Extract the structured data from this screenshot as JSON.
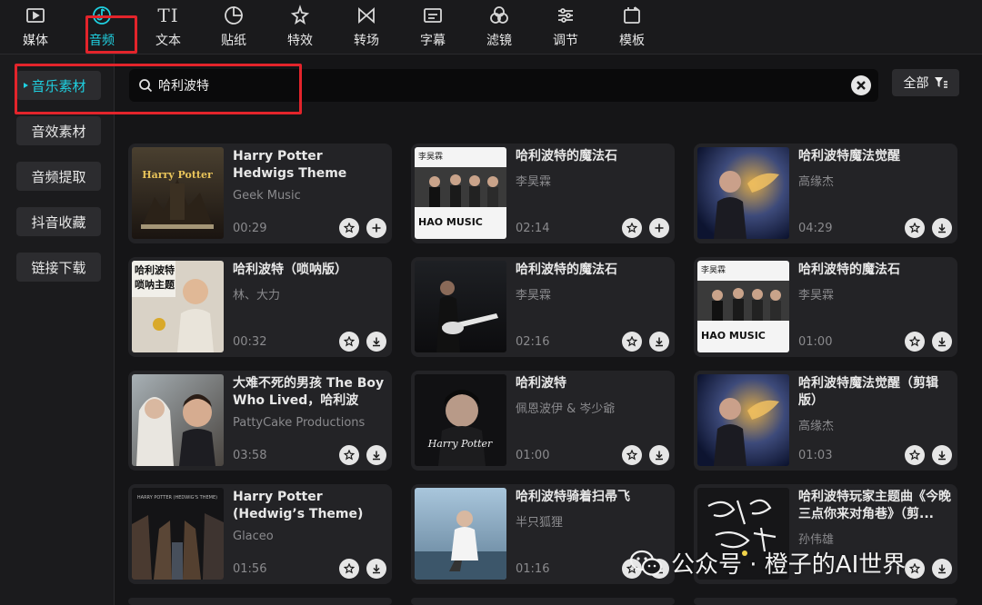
{
  "toolbar": {
    "items": [
      {
        "label": "媒体",
        "icon": "play-icon"
      },
      {
        "label": "音频",
        "icon": "audio-icon",
        "active": true
      },
      {
        "label": "文本",
        "icon": "text-icon"
      },
      {
        "label": "贴纸",
        "icon": "sticker-icon"
      },
      {
        "label": "特效",
        "icon": "sparkle-icon"
      },
      {
        "label": "转场",
        "icon": "transition-icon"
      },
      {
        "label": "字幕",
        "icon": "subtitle-icon"
      },
      {
        "label": "滤镜",
        "icon": "filter-icon"
      },
      {
        "label": "调节",
        "icon": "adjust-icon"
      },
      {
        "label": "模板",
        "icon": "template-icon"
      }
    ],
    "text_glyph": "TI"
  },
  "sidebar": {
    "items": [
      {
        "label": "音乐素材",
        "active": true
      },
      {
        "label": "音效素材"
      },
      {
        "label": "音频提取"
      },
      {
        "label": "抖音收藏"
      },
      {
        "label": "链接下载"
      }
    ]
  },
  "search": {
    "value": "哈利波特"
  },
  "filter": {
    "label": "全部"
  },
  "cards": [
    {
      "title": "Harry Potter Hedwigs Theme",
      "artist": "Geek Music",
      "duration": "00:29",
      "action": "add"
    },
    {
      "title": "哈利波特的魔法石",
      "artist": "李昊霖",
      "duration": "02:14",
      "action": "add"
    },
    {
      "title": "哈利波特魔法觉醒",
      "artist": "高缘杰",
      "duration": "04:29",
      "action": "download"
    },
    {
      "title": "哈利波特（唢呐版）",
      "artist": "林、大力",
      "duration": "00:32",
      "action": "download"
    },
    {
      "title": "哈利波特的魔法石",
      "artist": "李昊霖",
      "duration": "02:16",
      "action": "download"
    },
    {
      "title": "哈利波特的魔法石",
      "artist": "李昊霖",
      "duration": "01:00",
      "action": "download"
    },
    {
      "title": "大难不死的男孩 The Boy Who Lived，哈利波特...",
      "artist": "PattyCake Productions",
      "duration": "03:58",
      "action": "download"
    },
    {
      "title": "哈利波特",
      "artist": "佩恩波伊 & 岑少爺",
      "duration": "01:00",
      "action": "download"
    },
    {
      "title": "哈利波特魔法觉醒（剪辑版）",
      "artist": "高缘杰",
      "duration": "01:03",
      "action": "download"
    },
    {
      "title": "Harry Potter (Hedwig’s Theme)",
      "artist": "Glaceo",
      "duration": "01:56",
      "action": "download"
    },
    {
      "title": "哈利波特骑着扫帚飞",
      "artist": "半只狐狸",
      "duration": "01:16",
      "action": "download"
    },
    {
      "title": "哈利波特玩家主题曲《今晚三点你来对角巷》（剪...",
      "artist": "孙伟雄",
      "duration": "",
      "action": "download"
    }
  ],
  "thumb_text": {
    "hp_logo": "Harry Potter",
    "hao_music": "HAO MUSIC",
    "li_hao_lin": "李昊霖",
    "suona": "哈利波特\n唢呐主题",
    "signature": "Harry Potter"
  },
  "watermark": {
    "text": "公众号 · 橙子的AI世界"
  },
  "colors": {
    "accent": "#1fd0e0",
    "highlight": "#e3242b"
  }
}
